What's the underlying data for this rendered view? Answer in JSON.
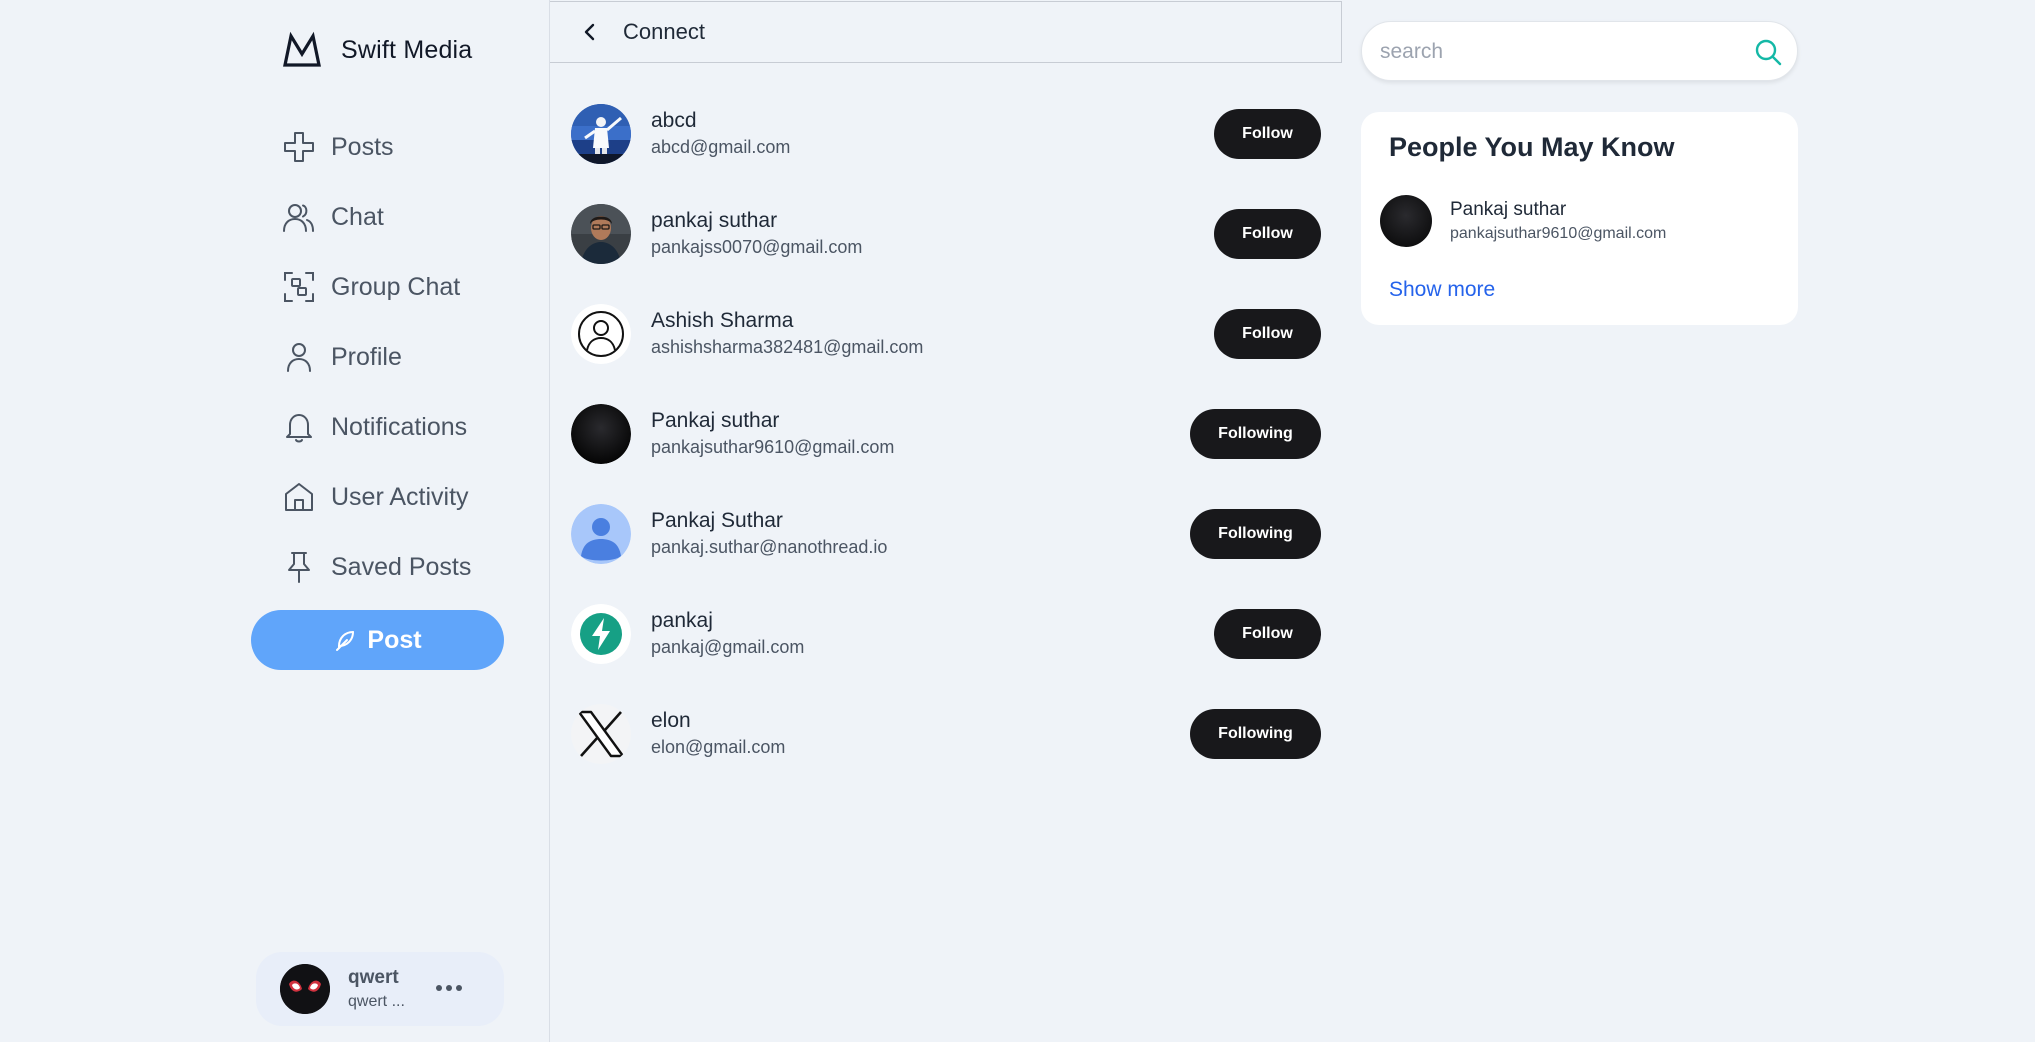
{
  "brand": {
    "name": "Swift Media",
    "logo_icon": "mountain-logo-icon"
  },
  "sidebar": {
    "items": [
      {
        "label": "Posts",
        "icon": "plus-cross-icon"
      },
      {
        "label": "Chat",
        "icon": "users-icon"
      },
      {
        "label": "Group Chat",
        "icon": "group-scan-icon"
      },
      {
        "label": "Profile",
        "icon": "user-icon"
      },
      {
        "label": "Notifications",
        "icon": "bell-icon"
      },
      {
        "label": "User Activity",
        "icon": "home-icon"
      },
      {
        "label": "Saved Posts",
        "icon": "pin-icon"
      }
    ],
    "post_button": {
      "label": "Post",
      "icon": "feather-icon",
      "color": "#60a5fa"
    },
    "user": {
      "name": "qwert",
      "handle": "qwert ..."
    }
  },
  "header": {
    "title": "Connect"
  },
  "users": [
    {
      "name": "abcd",
      "email": "abcd@gmail.com",
      "button": "Follow",
      "avatar": "photo-cricket"
    },
    {
      "name": "pankaj suthar",
      "email": "pankajss0070@gmail.com",
      "button": "Follow",
      "avatar": "photo-man"
    },
    {
      "name": "Ashish Sharma",
      "email": "ashishsharma382481@gmail.com",
      "button": "Follow",
      "avatar": "outline-person"
    },
    {
      "name": "Pankaj suthar",
      "email": "pankajsuthar9610@gmail.com",
      "button": "Following",
      "avatar": "dark-circle"
    },
    {
      "name": "Pankaj Suthar",
      "email": "pankaj.suthar@nanothread.io",
      "button": "Following",
      "avatar": "default-person"
    },
    {
      "name": "pankaj",
      "email": "pankaj@gmail.com",
      "button": "Follow",
      "avatar": "bolt-logo"
    },
    {
      "name": "elon",
      "email": "elon@gmail.com",
      "button": "Following",
      "avatar": "x-logo"
    }
  ],
  "search": {
    "placeholder": "search",
    "value": "",
    "accent": "#14b8a6"
  },
  "people_you_may_know": {
    "title": "People You May Know",
    "people": [
      {
        "name": "Pankaj suthar",
        "email": "pankajsuthar9610@gmail.com"
      }
    ],
    "show_more": "Show more"
  },
  "colors": {
    "background": "#eff3f8",
    "button_dark": "#18181b",
    "link": "#2563eb"
  }
}
